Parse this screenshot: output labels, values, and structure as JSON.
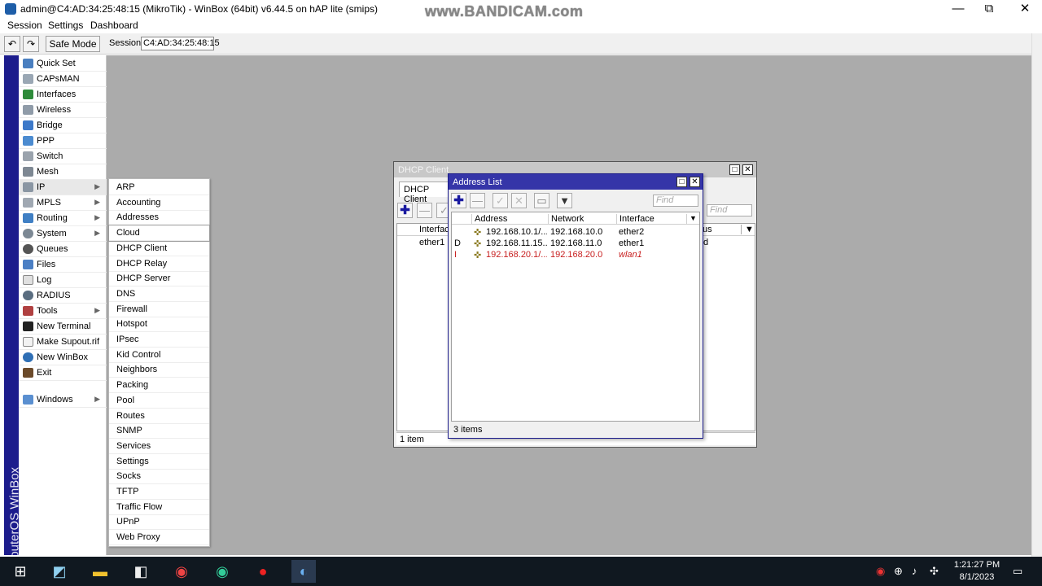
{
  "window": {
    "title": "admin@C4:AD:34:25:48:15 (MikroTik) - WinBox (64bit) v6.44.5 on hAP lite (smips)",
    "watermark": "www.BANDICAM.com",
    "minimize": "—",
    "maximize": "⧉",
    "close": "✕"
  },
  "menubar": {
    "session": "Session",
    "settings": "Settings",
    "dashboard": "Dashboard"
  },
  "toolbar": {
    "undo": "↶",
    "redo": "↷",
    "safe_mode": "Safe Mode",
    "session_label": "Session:",
    "session_value": "C4:AD:34:25:48:15"
  },
  "brand_strip": "RouterOS WinBox",
  "sidebar": {
    "items": [
      {
        "label": "Quick Set",
        "arrow": ""
      },
      {
        "label": "CAPsMAN",
        "arrow": ""
      },
      {
        "label": "Interfaces",
        "arrow": ""
      },
      {
        "label": "Wireless",
        "arrow": ""
      },
      {
        "label": "Bridge",
        "arrow": ""
      },
      {
        "label": "PPP",
        "arrow": ""
      },
      {
        "label": "Switch",
        "arrow": ""
      },
      {
        "label": "Mesh",
        "arrow": ""
      },
      {
        "label": "IP",
        "arrow": "▶"
      },
      {
        "label": "MPLS",
        "arrow": "▶"
      },
      {
        "label": "Routing",
        "arrow": "▶"
      },
      {
        "label": "System",
        "arrow": "▶"
      },
      {
        "label": "Queues",
        "arrow": ""
      },
      {
        "label": "Files",
        "arrow": ""
      },
      {
        "label": "Log",
        "arrow": ""
      },
      {
        "label": "RADIUS",
        "arrow": ""
      },
      {
        "label": "Tools",
        "arrow": "▶"
      },
      {
        "label": "New Terminal",
        "arrow": ""
      },
      {
        "label": "Make Supout.rif",
        "arrow": ""
      },
      {
        "label": "New WinBox",
        "arrow": ""
      },
      {
        "label": "Exit",
        "arrow": ""
      },
      {
        "label": "Windows",
        "arrow": "▶"
      }
    ]
  },
  "ip_menu": {
    "items": [
      "ARP",
      "Accounting",
      "Addresses",
      "Cloud",
      "DHCP Client",
      "DHCP Relay",
      "DHCP Server",
      "DNS",
      "Firewall",
      "Hotspot",
      "IPsec",
      "Kid Control",
      "Neighbors",
      "Packing",
      "Pool",
      "Routes",
      "SNMP",
      "Services",
      "Settings",
      "Socks",
      "TFTP",
      "Traffic Flow",
      "UPnP",
      "Web Proxy"
    ]
  },
  "dhcp_window": {
    "title": "DHCP Client",
    "tab": "DHCP Client",
    "col_interface": "Interfac",
    "col_status": "us",
    "row_interface": "ether1",
    "row_status": "d",
    "find": "Find",
    "status": "1 item"
  },
  "address_window": {
    "title": "Address List",
    "find": "Find",
    "columns": {
      "address": "Address",
      "network": "Network",
      "interface": "Interface"
    },
    "rows": [
      {
        "flag": "",
        "address": "192.168.10.1/...",
        "network": "192.168.10.0",
        "interface": "ether2",
        "disabled": false
      },
      {
        "flag": "D",
        "address": "192.168.11.15...",
        "network": "192.168.11.0",
        "interface": "ether1",
        "disabled": false
      },
      {
        "flag": "I",
        "address": "192.168.20.1/...",
        "network": "192.168.20.0",
        "interface": "wlan1",
        "disabled": true
      }
    ],
    "status": "3 items"
  },
  "taskbar": {
    "clock_time": "1:21:27 PM",
    "clock_date": "8/1/2023"
  },
  "colors": {
    "brand_strip": "#1c1c8c",
    "active_title": "#3535a8",
    "inactive_title": "#c8c8c8",
    "workspace": "#ababab",
    "disabled_row": "#c82020"
  }
}
